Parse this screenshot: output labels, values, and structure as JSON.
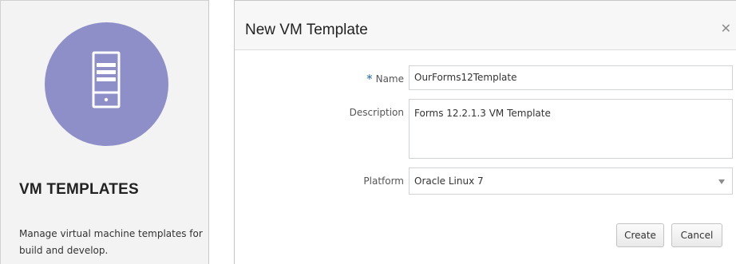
{
  "card": {
    "icon": "server-tower-icon",
    "title": "VM TEMPLATES",
    "description": "Manage virtual machine templates for build and develop."
  },
  "dialog": {
    "title": "New VM Template",
    "close_icon": "close-icon",
    "name": {
      "required_mark": "*",
      "label": "Name",
      "value": "OurForms12Template"
    },
    "description": {
      "label": "Description",
      "value": "Forms 12.2.1.3 VM Template"
    },
    "platform": {
      "label": "Platform",
      "value": "Oracle Linux 7"
    },
    "create_label": "Create",
    "cancel_label": "Cancel"
  },
  "colors": {
    "card_bg": "#f3f3f3",
    "icon_circle": "#8e8fc9",
    "required_star": "#1f66a8"
  }
}
